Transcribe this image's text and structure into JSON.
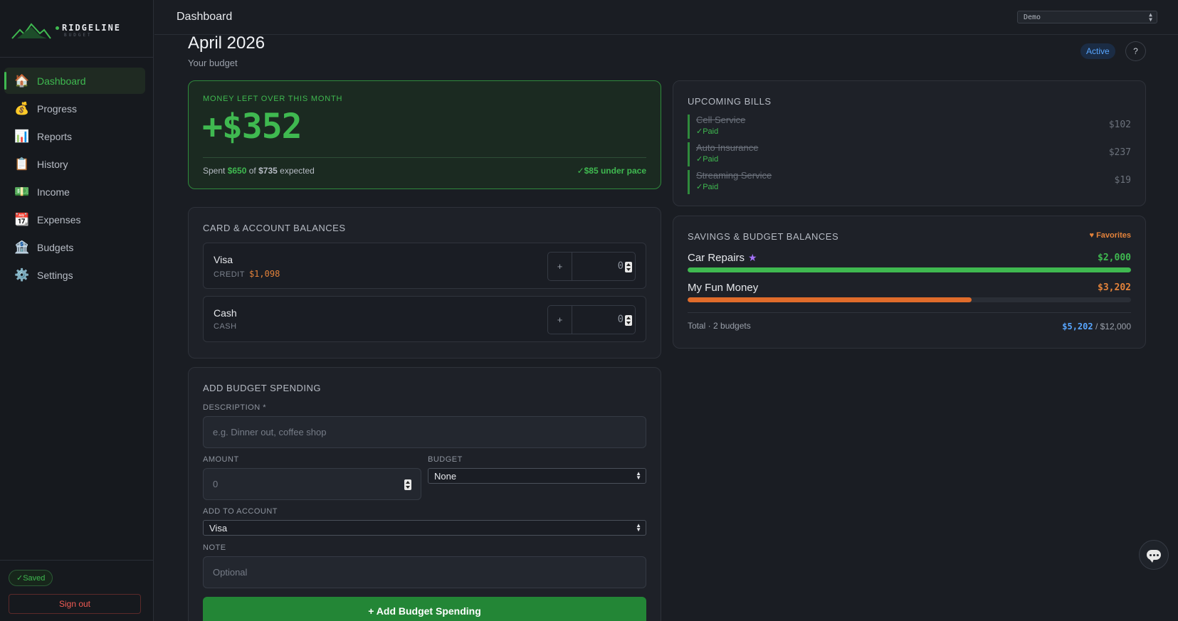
{
  "app": {
    "brand": "RIDGELINE",
    "brand_sub": "BUDGET"
  },
  "sidebar": {
    "items": [
      {
        "label": "Dashboard",
        "icon": "🏠",
        "icon_name": "house-icon"
      },
      {
        "label": "Progress",
        "icon": "💰",
        "icon_name": "money-bag-icon"
      },
      {
        "label": "Reports",
        "icon": "📊",
        "icon_name": "bar-chart-icon"
      },
      {
        "label": "History",
        "icon": "📋",
        "icon_name": "clipboard-icon"
      },
      {
        "label": "Income",
        "icon": "💵",
        "icon_name": "cash-icon"
      },
      {
        "label": "Expenses",
        "icon": "📆",
        "icon_name": "calendar-icon"
      },
      {
        "label": "Budgets",
        "icon": "🏦",
        "icon_name": "bank-icon"
      },
      {
        "label": "Settings",
        "icon": "⚙️",
        "icon_name": "gear-icon"
      }
    ],
    "active_index": 0,
    "saved_label": "✓Saved",
    "signout_label": "Sign out"
  },
  "header": {
    "title": "Dashboard",
    "profile_select": "Demo"
  },
  "page": {
    "title": "April 2026",
    "subtitle": "Your budget",
    "status_badge": "Active",
    "help_label": "?"
  },
  "summary": {
    "label": "MONEY LEFT OVER THIS MONTH",
    "value": "+$352",
    "spent_prefix": "Spent",
    "spent": "$650",
    "of": "of",
    "expected": "$735",
    "expected_suffix": "expected",
    "pace": "✓$85 under pace"
  },
  "balances": {
    "title": "CARD & ACCOUNT BALANCES",
    "accounts": [
      {
        "name": "Visa",
        "type": "CREDIT",
        "balance": "$1,098",
        "plus": "+",
        "input_value": "0"
      },
      {
        "name": "Cash",
        "type": "CASH",
        "balance": "",
        "plus": "+",
        "input_value": "0"
      }
    ]
  },
  "add_spending": {
    "title": "ADD BUDGET SPENDING",
    "description_label": "DESCRIPTION *",
    "description_placeholder": "e.g. Dinner out, coffee shop",
    "amount_label": "AMOUNT",
    "amount_placeholder": "0",
    "budget_label": "BUDGET",
    "budget_value": "None",
    "account_label": "ADD TO ACCOUNT",
    "account_value": "Visa",
    "note_label": "NOTE",
    "note_placeholder": "Optional",
    "submit_label": "+ Add Budget Spending"
  },
  "bills": {
    "title": "UPCOMING BILLS",
    "items": [
      {
        "name": "Cell Service",
        "status": "✓Paid",
        "amount": "$102"
      },
      {
        "name": "Auto Insurance",
        "status": "✓Paid",
        "amount": "$237"
      },
      {
        "name": "Streaming Service",
        "status": "✓Paid",
        "amount": "$19"
      }
    ]
  },
  "savings": {
    "title": "SAVINGS & BUDGET BALANCES",
    "favorites_label": "♥ Favorites",
    "items": [
      {
        "name": "Car Repairs",
        "star": "★",
        "amount": "$2,000",
        "fill_fraction": 1.0,
        "color": "#3fb950"
      },
      {
        "name": "My Fun Money",
        "star": "",
        "amount": "$3,202",
        "fill_fraction": 0.64,
        "color": "#e06c2b"
      }
    ],
    "total_label": "Total · 2 budgets",
    "total_amount": "$5,202",
    "total_goal": "/ $12,000"
  },
  "colors": {
    "accent_green": "#3fb950",
    "accent_orange": "#e3823a",
    "accent_blue": "#58a6ff",
    "accent_purple": "#a371f7",
    "danger": "#f25c54"
  }
}
